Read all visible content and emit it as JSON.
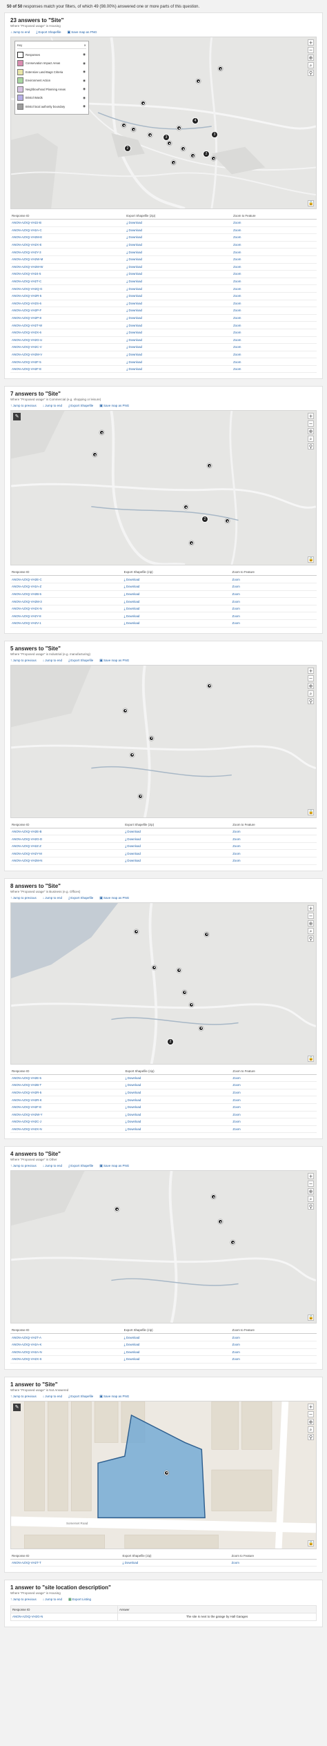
{
  "header": {
    "count_bold": "50 of 50",
    "text": "responses match your filters, of which 49 (98.00%) answered one or more parts of this question."
  },
  "icons": {
    "zoom_in": "plus-icon",
    "zoom_out": "minus-icon",
    "locate": "crosshair-icon",
    "search": "search-icon",
    "pin": "pin-icon",
    "lock": "lock-icon",
    "select": "pencil-icon",
    "download": "download-icon",
    "map": "map-icon",
    "excel": "excel-icon"
  },
  "colors": {
    "link": "#1d5fa8",
    "map_bg": "#e6e6e4",
    "water": "#a7b7c6",
    "polygon": "#6ea8d4"
  },
  "legend": {
    "title": "Key",
    "items": [
      {
        "label": "Responses",
        "color": "#ffffff"
      },
      {
        "label": "Conservation Impact Areas",
        "color": "#d98db0"
      },
      {
        "label": "Extensive Land-Bags Criteria",
        "color": "#e8e5a8"
      },
      {
        "label": "Environment Action",
        "color": "#a9d7a2"
      },
      {
        "label": "Neighbourhood Planning Areas",
        "color": "#d7c3e3"
      },
      {
        "label": "Bristol Wards",
        "color": "#b6aee6"
      },
      {
        "label": "Bristol local authority boundary",
        "color": "#9d9d9d"
      }
    ]
  },
  "cols": {
    "id": "Response ID",
    "export": "Export Shapefile (zip)",
    "zoom": "Zoom to Feature"
  },
  "dl": "Download",
  "zm": "Zoom",
  "sections": [
    {
      "title": "23 answers to \"Site\"",
      "where": "Where \"Proposed usage\" is Housing",
      "tools": [
        "Jump to end",
        "Export Shapefile",
        "Save map as PNG"
      ],
      "cols": [
        "Response ID",
        "Export Shapefile (zip)",
        "Zoom to Feature"
      ],
      "rows": [
        "ANON-AZXQ-VH22-B",
        "ANON-AZXQ-VH2A-C",
        "ANON-AZXQ-VH2M-E",
        "ANON-AZXQ-VH2X-E",
        "ANON-AZXQ-VH2Y-3",
        "ANON-AZXQ-VH2W-M",
        "ANON-AZXQ-VH2M-W",
        "ANON-AZXQ-VH24-5",
        "ANON-AZXQ-VH2T-C",
        "ANON-AZXQ-VH2Q-G",
        "ANON-AZXQ-VH2R-5",
        "ANON-AZXQ-VH2S-6",
        "ANON-AZXQ-VH2P-F",
        "ANON-AZXQ-VH2P-8",
        "ANON-AZXQ-VH2T-W",
        "ANON-AZXQ-VH2X-6",
        "ANON-AZXQ-VH2G-U",
        "ANON-AZXQ-VH2C-V",
        "ANON-AZXQ-VH2M-V",
        "ANON-AZXQ-VH2F-5",
        "ANON-AZXQ-VH2F-E"
      ]
    },
    {
      "title": "7 answers to \"Site\"",
      "where": "Where \"Proposed usage\" is Commercial (e.g. shopping or leisure)",
      "tools": [
        "Jump to previous",
        "Jump to end",
        "Export Shapefile",
        "Save map as PNG"
      ],
      "cols": [
        "Response ID",
        "Export Shapefile (zip)",
        "Zoom to Feature"
      ],
      "rows": [
        "ANON-AZXQ-VH2E-C",
        "ANON-AZXQ-VH2A-Z",
        "ANON-AZXQ-VH2B-5",
        "ANON-AZXQ-VH2M-3",
        "ANON-AZXQ-VH2X-N",
        "ANON-AZXQ-VH2Y-8",
        "ANON-AZXQ-VH2V-1"
      ]
    },
    {
      "title": "5 answers to \"Site\"",
      "where": "Where \"Proposed usage\" is Industrial (e.g. manufacturing)",
      "tools": [
        "Jump to previous",
        "Jump to end",
        "Export Shapefile",
        "Save map as PNG"
      ],
      "cols": [
        "Response ID",
        "Export Shapefile (zip)",
        "Zoom to Feature"
      ],
      "rows": [
        "ANON-AZXQ-VH2E-B",
        "ANON-AZXQ-VH2G-D",
        "ANON-AZXQ-VH2Z-Z",
        "ANON-AZXQ-VH2Y-M",
        "ANON-AZXQ-VH2M-N"
      ]
    },
    {
      "title": "8 answers to \"Site\"",
      "where": "Where \"Proposed usage\" is Business (e.g. Offices)",
      "tools": [
        "Jump to previous",
        "Jump to end",
        "Export Shapefile",
        "Save map as PNG"
      ],
      "cols": [
        "Response ID",
        "Export Shapefile (zip)",
        "Zoom to Feature"
      ],
      "rows": [
        "ANON-AZXQ-VH2E-5",
        "ANON-AZXQ-VH2B-T",
        "ANON-AZXQ-VH2R-5",
        "ANON-AZXQ-VH2R-K",
        "ANON-AZXQ-VH2F-E",
        "ANON-AZXQ-VH2W-Y",
        "ANON-AZXQ-VH2C-J",
        "ANON-AZXQ-VH2X-N"
      ]
    },
    {
      "title": "4 answers to \"Site\"",
      "where": "Where \"Proposed usage\" is Other",
      "tools": [
        "Jump to previous",
        "Jump to end",
        "Export Shapefile",
        "Save map as PNG"
      ],
      "cols": [
        "Response ID",
        "Export Shapefile (zip)",
        "Zoom to Feature"
      ],
      "rows": [
        "ANON-AZXQ-VH2T-A",
        "ANON-AZXQ-VH2A-K",
        "ANON-AZXQ-VH2A-N",
        "ANON-AZXQ-VH2X-S"
      ]
    },
    {
      "title": "1 answer to \"Site\"",
      "where": "Where \"Proposed usage\" is Not Answered",
      "tools": [
        "Jump to previous",
        "Jump to end",
        "Export Shapefile",
        "Save map as PNG"
      ],
      "cols": [
        "Response ID",
        "Export Shapefile (zip)",
        "Zoom to Feature"
      ],
      "rows": [
        "ANON-AZXQ-VH2T-T"
      ],
      "street": "Somerset Road"
    }
  ],
  "final": {
    "title": "1 answer to \"site location description\"",
    "where": "Where \"Proposed usage\" is Housing",
    "tools": [
      "Jump to previous",
      "Jump to end",
      "Export Listing"
    ],
    "cols": [
      "Response ID",
      "Answer"
    ],
    "row": [
      "ANON-AZXQ-VH2G-N",
      "The site is next to the garage by Hall Garages"
    ]
  }
}
